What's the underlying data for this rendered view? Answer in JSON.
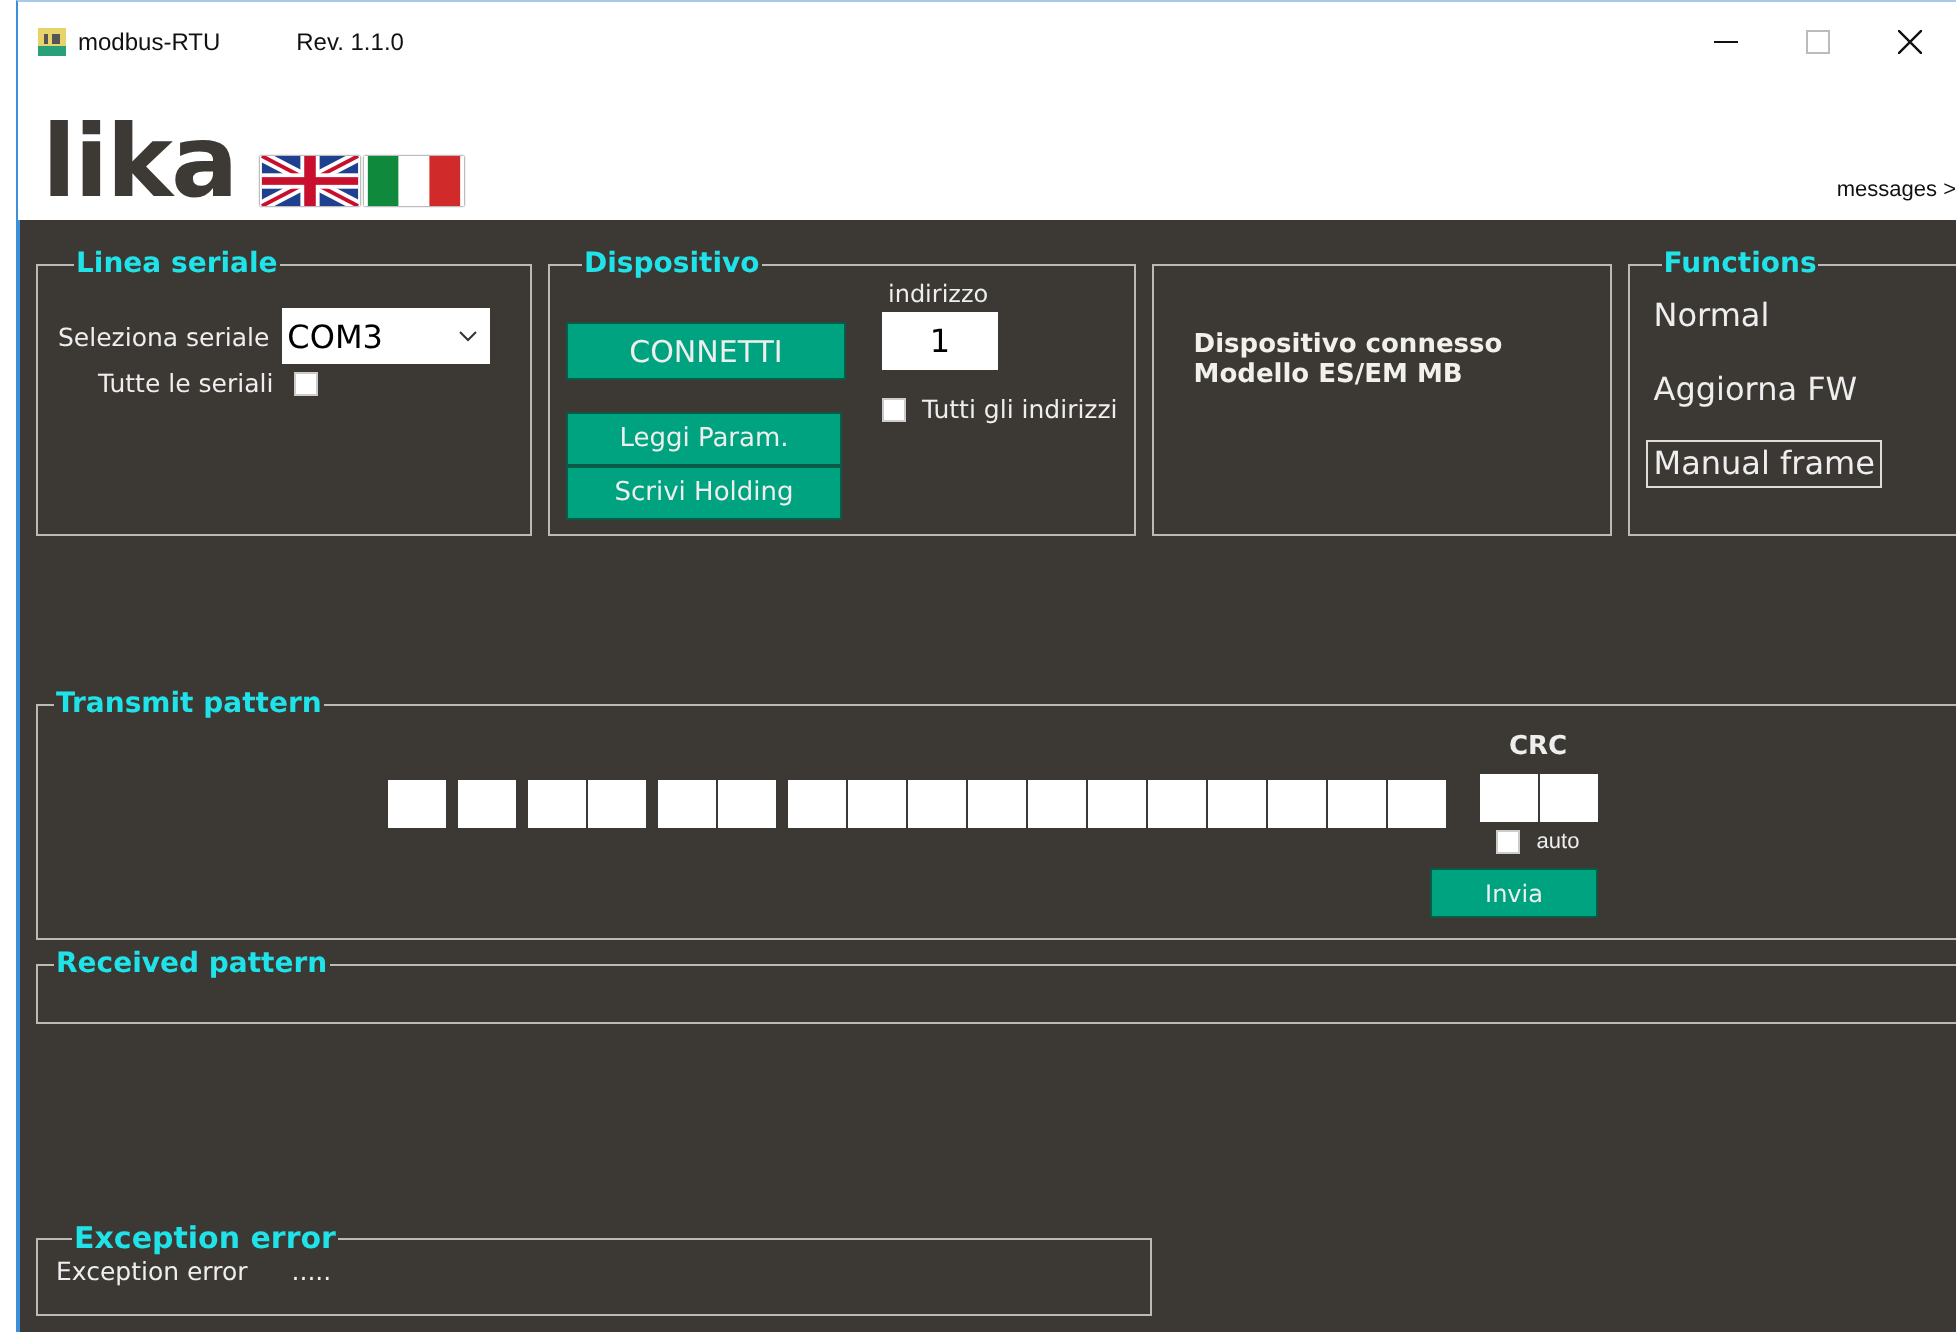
{
  "window": {
    "app_name": "modbus-RTU",
    "revision": "Rev. 1.1.0",
    "logo": "lika",
    "messages_link": "messages >"
  },
  "serial_line": {
    "title": "Linea seriale",
    "port_label": "Seleziona seriale",
    "port_value": "COM3",
    "all_ports_label": "Tutte le seriali",
    "all_ports_checked": false
  },
  "device": {
    "title": "Dispositivo",
    "connect_button": "CONNETTI",
    "address_label": "indirizzo",
    "address_value": "1",
    "all_addresses_label": "Tutti gli indirizzi",
    "all_addresses_checked": false,
    "buttons": [
      "Leggi Param.",
      "Scrivi Holding"
    ]
  },
  "status": {
    "lines": [
      "Dispositivo connesso",
      "Modello  ES/EM MB"
    ]
  },
  "functions": {
    "title": "Functions",
    "items": [
      {
        "label": "Normal",
        "selected": false
      },
      {
        "label": "Aggiorna FW",
        "selected": false
      },
      {
        "label": "Manual frame",
        "selected": true
      }
    ]
  },
  "transmit": {
    "title": "Transmit pattern",
    "crc_label": "CRC",
    "auto_label": "auto",
    "auto_checked": false,
    "send_button": "Invia"
  },
  "received": {
    "title": "Received pattern"
  },
  "exception": {
    "title": "Exception error",
    "label": "Exception error",
    "value": "....."
  }
}
